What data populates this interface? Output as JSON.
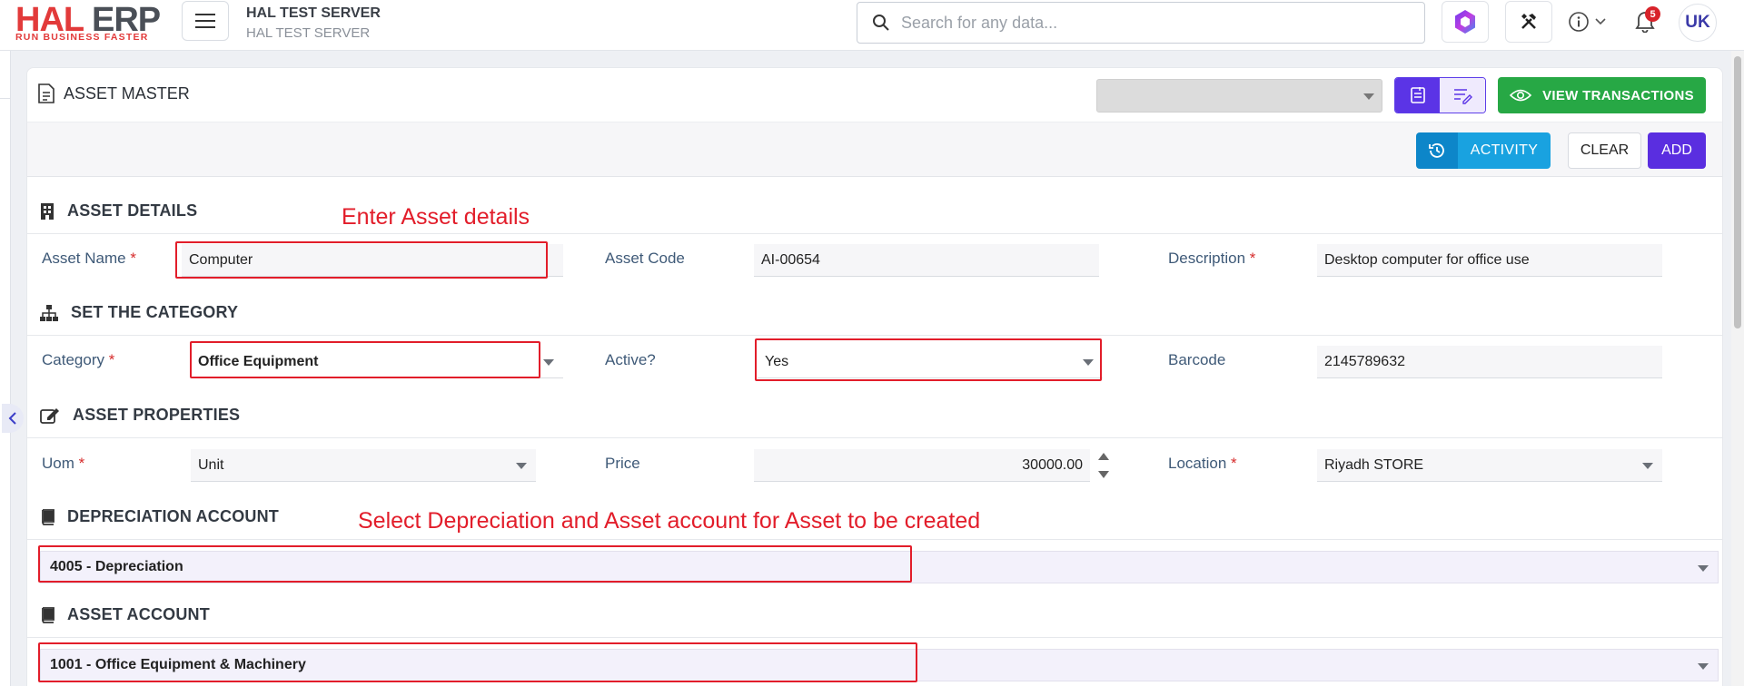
{
  "app": {
    "logo_main": "HAL",
    "logo_second": "ERP",
    "logo_tagline": "RUN BUSINESS FASTER",
    "server_name": "HAL TEST SERVER",
    "server_sub": "HAL TEST SERVER",
    "search_placeholder": "Search for any data...",
    "notification_count": "5",
    "user_initials": "UK"
  },
  "page": {
    "title": "ASSET MASTER",
    "top_select_value": "",
    "view_transactions_label": "VIEW TRANSACTIONS",
    "activity_label": "ACTIVITY",
    "clear_label": "CLEAR",
    "add_label": "ADD"
  },
  "sections": {
    "asset_details": "ASSET DETAILS",
    "set_category": "SET THE CATEGORY",
    "asset_properties": "ASSET PROPERTIES",
    "depreciation_account": "DEPRECIATION ACCOUNT",
    "asset_account": "ASSET ACCOUNT"
  },
  "fields": {
    "asset_name_label": "Asset Name",
    "asset_name_value": "Computer",
    "asset_code_label": "Asset Code",
    "asset_code_value": "AI-00654",
    "description_label": "Description",
    "description_value": "Desktop computer for office use",
    "category_label": "Category",
    "category_value": "Office Equipment",
    "active_label": "Active?",
    "active_value": "Yes",
    "barcode_label": "Barcode",
    "barcode_value": "2145789632",
    "uom_label": "Uom",
    "uom_value": "Unit",
    "price_label": "Price",
    "price_value": "30000.00",
    "location_label": "Location",
    "location_value": "Riyadh STORE",
    "depreciation_account_value": "4005 - Depreciation",
    "asset_account_value": "1001 - Office Equipment & Machinery",
    "required_mark": "*"
  },
  "annotations": {
    "asset_details_note": "Enter Asset details",
    "accounts_note": "Select Depreciation and Asset account for Asset to be created"
  },
  "colors": {
    "accent_purple": "#5a2ee0",
    "view_green": "#27a845",
    "activity_blue": "#19a2e0",
    "annotation_red": "#e21d2a",
    "logo_red": "#e23a3a"
  }
}
